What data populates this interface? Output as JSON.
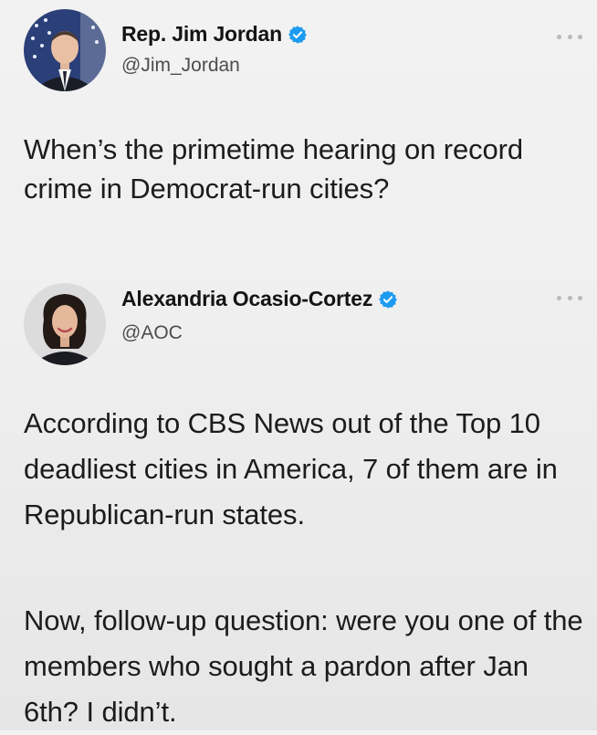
{
  "tweets": [
    {
      "name": "Rep. Jim Jordan",
      "handle": "@Jim_Jordan",
      "verified": true,
      "text": "When’s the primetime hearing on record crime in Democrat-run cities?"
    },
    {
      "name": "Alexandria Ocasio-Cortez",
      "handle": "@AOC",
      "verified": true,
      "paragraphs": [
        "According to CBS News out of the Top 10 deadliest cities in America, 7 of them are in Republican-run states.",
        "Now, follow-up question: were you one of the members who sought a pardon after Jan 6th? I didn’t."
      ]
    }
  ],
  "icons": {
    "verified": "verified-badge-icon",
    "more": "more-options-icon"
  },
  "colors": {
    "verified": "#1d9bf0",
    "background": "#efefef",
    "text": "#1c1c1c",
    "handle": "#4d4d4d"
  }
}
